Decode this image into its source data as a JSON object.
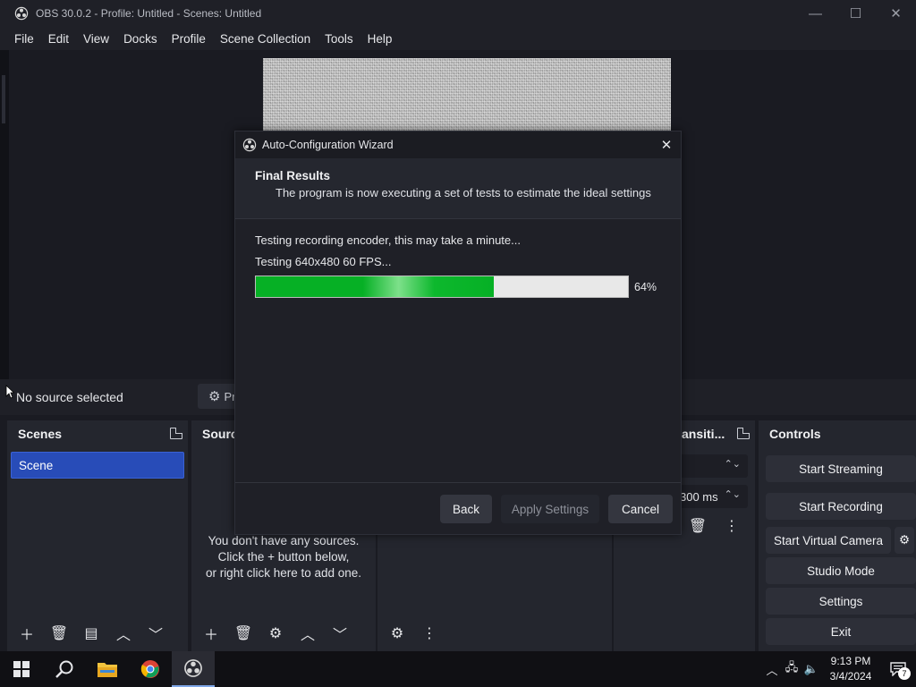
{
  "window": {
    "title": "OBS 30.0.2 - Profile: Untitled - Scenes: Untitled",
    "minimize": "—",
    "maximize": "☐",
    "close": "✕"
  },
  "menu": [
    "File",
    "Edit",
    "View",
    "Docks",
    "Profile",
    "Scene Collection",
    "Tools",
    "Help"
  ],
  "source_bar": {
    "no_source": "No source selected",
    "properties_label": "Pr"
  },
  "docks": {
    "scenes": {
      "title": "Scenes",
      "items": [
        "Scene"
      ]
    },
    "sources": {
      "title": "Sourc",
      "empty_lines": [
        "You don't have any sources.",
        "Click the + button below,",
        "or right click here to add one."
      ]
    },
    "transitions": {
      "title": "ansiti...",
      "duration": "300 ms"
    },
    "controls": {
      "title": "Controls",
      "buttons": [
        "Start Streaming",
        "Start Recording",
        "Start Virtual Camera",
        "Studio Mode",
        "Settings",
        "Exit"
      ]
    }
  },
  "dialog": {
    "title": "Auto-Configuration Wizard",
    "header_title": "Final Results",
    "header_subtitle": "The program is now executing a set of tests to estimate the ideal settings",
    "status_1": "Testing recording encoder, this may take a minute...",
    "status_2": "Testing 640x480 60 FPS...",
    "progress_percent": 64,
    "progress_label": "64%",
    "back": "Back",
    "apply": "Apply Settings",
    "cancel": "Cancel"
  },
  "taskbar": {
    "time": "9:13 PM",
    "date": "3/4/2024",
    "notifications": "7"
  },
  "colors": {
    "accent_scene": "#284cb8",
    "progress_green": "#06b025",
    "chrome_bg": "#1f2027",
    "dock_bg": "#24262e"
  }
}
